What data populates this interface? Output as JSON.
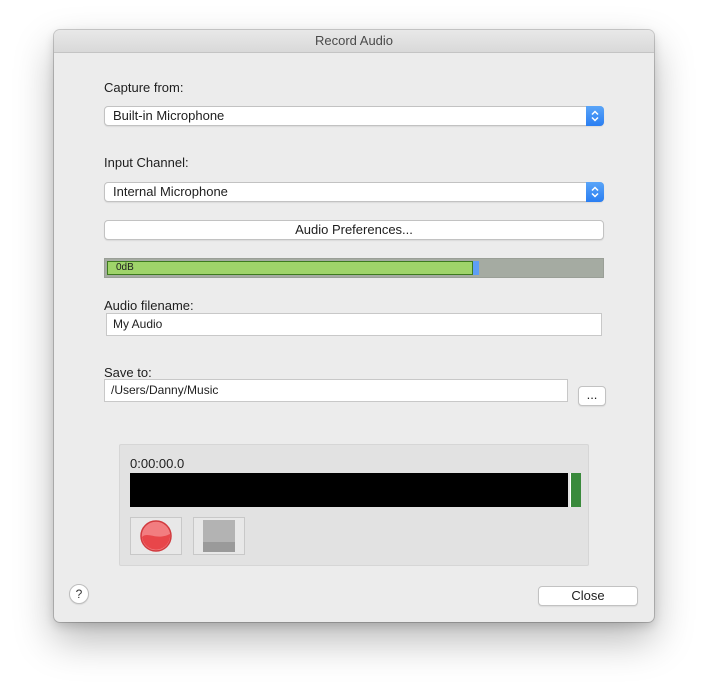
{
  "window": {
    "title": "Record Audio"
  },
  "capture": {
    "label": "Capture from:",
    "selected": "Built-in Microphone"
  },
  "channel": {
    "label": "Input Channel:",
    "selected": "Internal Microphone"
  },
  "preferences_button": "Audio Preferences...",
  "level_meter": {
    "label": "0dB",
    "level_fraction": 0.75
  },
  "filename": {
    "label": "Audio filename:",
    "value": "My Audio"
  },
  "save_to": {
    "label": "Save to:",
    "value": "/Users/Danny/Music",
    "browse_label": "..."
  },
  "recorder": {
    "time": "0:00:00.0"
  },
  "help_label": "?",
  "close_label": "Close",
  "colors": {
    "meter_fill": "#9fd46a",
    "meter_knob": "#5e9ef5",
    "record_red": "#e8464a",
    "level_green": "#3a8a3c"
  },
  "icons": {
    "stepper": "chevron-up-down-icon",
    "record": "record-icon",
    "stop": "stop-icon"
  }
}
